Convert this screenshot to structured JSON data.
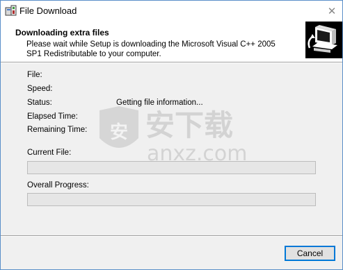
{
  "window": {
    "title": "File Download"
  },
  "header": {
    "title": "Downloading extra files",
    "description": "Please wait while Setup is downloading the Microsoft Visual C++ 2005 SP1 Redistributable to your computer."
  },
  "fields": {
    "file_label": "File:",
    "file_value": "",
    "speed_label": "Speed:",
    "speed_value": "",
    "status_label": "Status:",
    "status_value": "Getting file information...",
    "elapsed_label": "Elapsed Time:",
    "elapsed_value": "",
    "remaining_label": "Remaining Time:",
    "remaining_value": ""
  },
  "progress": {
    "current_file_label": "Current File:",
    "current_file_percent": 0,
    "overall_label": "Overall Progress:",
    "overall_percent": 0
  },
  "buttons": {
    "cancel_label": "Cancel"
  },
  "watermark": {
    "text_cn": "安下载",
    "text_en": "anxz.com"
  },
  "icons": {
    "app": "setup-installer-icon",
    "close": "close-icon",
    "header": "computer-download-icon"
  },
  "colors": {
    "accent": "#0078d7",
    "progress_fill": "#06b025"
  }
}
